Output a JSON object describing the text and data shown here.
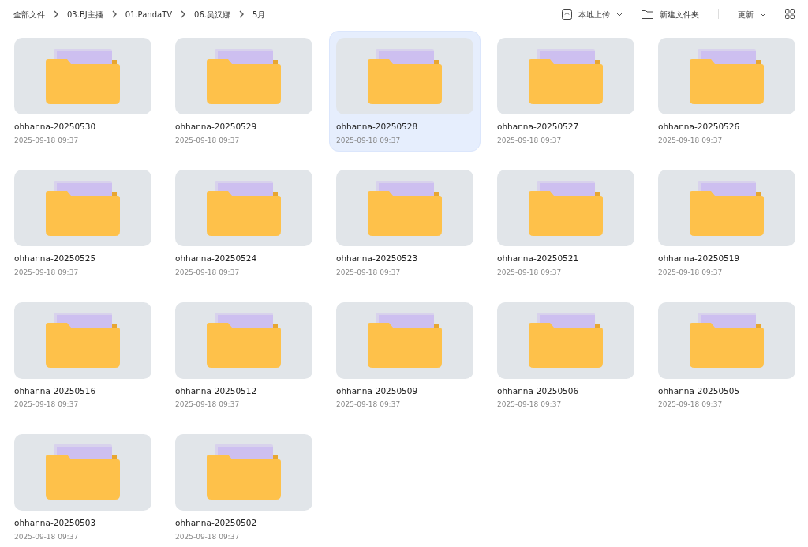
{
  "breadcrumb": [
    "全部文件",
    "03.BJ主播",
    "01.PandaTV",
    "06.吴汉娜",
    "5月"
  ],
  "toolbar": {
    "upload": "本地上传",
    "new_folder": "新建文件夹",
    "sort": "更新"
  },
  "folders": [
    {
      "name": "ohhanna-20250530",
      "date": "2025-09-18 09:37",
      "selected": false
    },
    {
      "name": "ohhanna-20250529",
      "date": "2025-09-18 09:37",
      "selected": false
    },
    {
      "name": "ohhanna-20250528",
      "date": "2025-09-18 09:37",
      "selected": true
    },
    {
      "name": "ohhanna-20250527",
      "date": "2025-09-18 09:37",
      "selected": false
    },
    {
      "name": "ohhanna-20250526",
      "date": "2025-09-18 09:37",
      "selected": false
    },
    {
      "name": "ohhanna-20250525",
      "date": "2025-09-18 09:37",
      "selected": false
    },
    {
      "name": "ohhanna-20250524",
      "date": "2025-09-18 09:37",
      "selected": false
    },
    {
      "name": "ohhanna-20250523",
      "date": "2025-09-18 09:37",
      "selected": false
    },
    {
      "name": "ohhanna-20250521",
      "date": "2025-09-18 09:37",
      "selected": false
    },
    {
      "name": "ohhanna-20250519",
      "date": "2025-09-18 09:37",
      "selected": false
    },
    {
      "name": "ohhanna-20250516",
      "date": "2025-09-18 09:37",
      "selected": false
    },
    {
      "name": "ohhanna-20250512",
      "date": "2025-09-18 09:37",
      "selected": false
    },
    {
      "name": "ohhanna-20250509",
      "date": "2025-09-18 09:37",
      "selected": false
    },
    {
      "name": "ohhanna-20250506",
      "date": "2025-09-18 09:37",
      "selected": false
    },
    {
      "name": "ohhanna-20250505",
      "date": "2025-09-18 09:37",
      "selected": false
    },
    {
      "name": "ohhanna-20250503",
      "date": "2025-09-18 09:37",
      "selected": false
    },
    {
      "name": "ohhanna-20250502",
      "date": "2025-09-18 09:37",
      "selected": false
    }
  ]
}
